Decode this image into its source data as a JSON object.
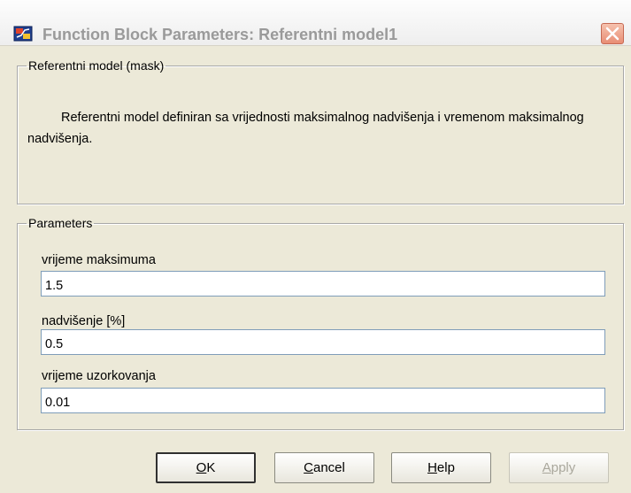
{
  "window": {
    "title": "Function Block Parameters: Referentni model1",
    "icon": "simulink-block-icon",
    "close_icon": "close-icon"
  },
  "mask": {
    "legend": "Referentni model (mask)",
    "description": "Referentni model definiran sa vrijednosti maksimalnog nadvišenja i vremenom maksimalnog nadvišenja."
  },
  "parameters": {
    "legend": "Parameters",
    "fields": [
      {
        "label": "vrijeme maksimuma",
        "value": "1.5"
      },
      {
        "label": "nadvišenje [%]",
        "value": "0.5"
      },
      {
        "label": "vrijeme uzorkovanja",
        "value": "0.01"
      }
    ]
  },
  "buttons": {
    "ok": {
      "mnemonic": "O",
      "rest": "K"
    },
    "cancel": {
      "mnemonic": "C",
      "rest": "ancel"
    },
    "help": {
      "mnemonic": "H",
      "rest": "elp"
    },
    "apply": {
      "mnemonic": "A",
      "rest": "pply"
    }
  }
}
